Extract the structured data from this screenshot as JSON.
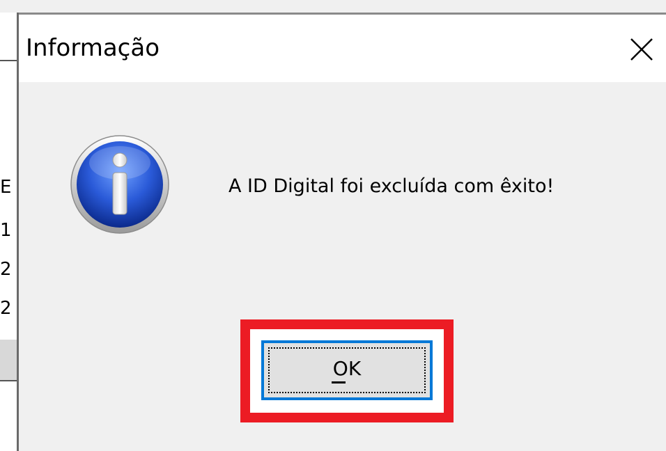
{
  "dialog": {
    "title": "Informação",
    "message": "A ID Digital foi excluída com êxito!",
    "ok_label": "OK",
    "icon": "information-icon",
    "close_icon": "close-icon",
    "highlight_color": "#ec1c24",
    "focus_color": "#0078d7"
  },
  "background_window": {
    "visible_chars": [
      "E",
      "1",
      "2",
      "2"
    ]
  }
}
